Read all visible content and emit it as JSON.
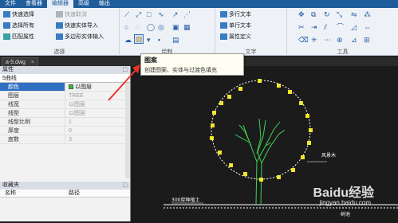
{
  "menubar": {
    "tabs": [
      "文件",
      "查看器",
      "编辑器",
      "高级",
      "输出"
    ],
    "active_index": 2
  },
  "ribbon": {
    "select_group": {
      "label": "选择",
      "quick_select": "快速选择",
      "select_all": "选择所有",
      "match_props": "匹配属性",
      "quick_deselect": "快速取消",
      "quick_import": "快速实体导入",
      "polygon_import": "多边形实体输入"
    },
    "draw_group": {
      "label": "绘制"
    },
    "text_group": {
      "label": "文字",
      "mtext": "多行文本",
      "stext": "单行文本",
      "attdef": "属性定义"
    },
    "tools_group": {
      "label": "工具"
    }
  },
  "tooltip": {
    "title": "图案",
    "description": "创建图案、实体与过渡色填充"
  },
  "document": {
    "tab_label": "a-5.dwg",
    "close_glyph": "×"
  },
  "properties": {
    "title": "属性",
    "pin_glyph": "⬚",
    "selection": "5曲线",
    "rows": [
      {
        "key": "颜色",
        "value": "以图层"
      },
      {
        "key": "图层",
        "value": "TREE"
      },
      {
        "key": "线宽",
        "value": "以图层"
      },
      {
        "key": "线型",
        "value": "以图层"
      },
      {
        "key": "线型比例",
        "value": "1"
      },
      {
        "key": "厚度",
        "value": "0"
      },
      {
        "key": "度数",
        "value": "3"
      }
    ]
  },
  "favorites": {
    "title": "收藏夹",
    "pin_glyph": "⬚",
    "col_name": "名称",
    "col_path": "路径"
  },
  "canvas": {
    "label_right": "风景木",
    "label_bottom_left": "300厚种植土",
    "label_bottom": "树池",
    "colors": {
      "tree": "#3fd44f",
      "grips": "#f5e62a",
      "circle": "#ffffff",
      "ground": "#ffffff"
    }
  },
  "watermark": {
    "text": "Baidu经验",
    "url": "jingyan.baidu.com"
  }
}
